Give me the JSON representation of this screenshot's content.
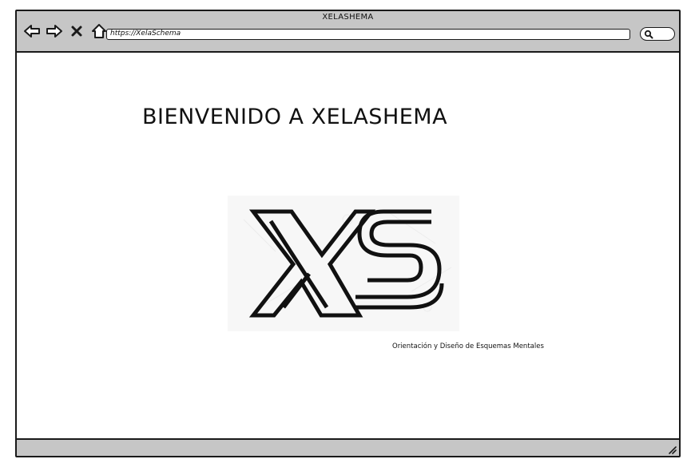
{
  "window": {
    "title": "XELASHEMA"
  },
  "nav": {
    "back_icon": "arrow-left-icon",
    "forward_icon": "arrow-right-icon",
    "stop_icon": "close-icon",
    "home_icon": "home-icon"
  },
  "address_bar": {
    "url": "https://XelaSchema"
  },
  "search": {
    "icon": "search-icon"
  },
  "page": {
    "heading": "BIENVENIDO A XELASHEMA",
    "logo_text": "XS",
    "tagline": "Orientación y Diseño de Esquemas Mentales"
  },
  "colors": {
    "chrome": "#c6c6c6",
    "border": "#1a1a1a",
    "background": "#ffffff"
  }
}
